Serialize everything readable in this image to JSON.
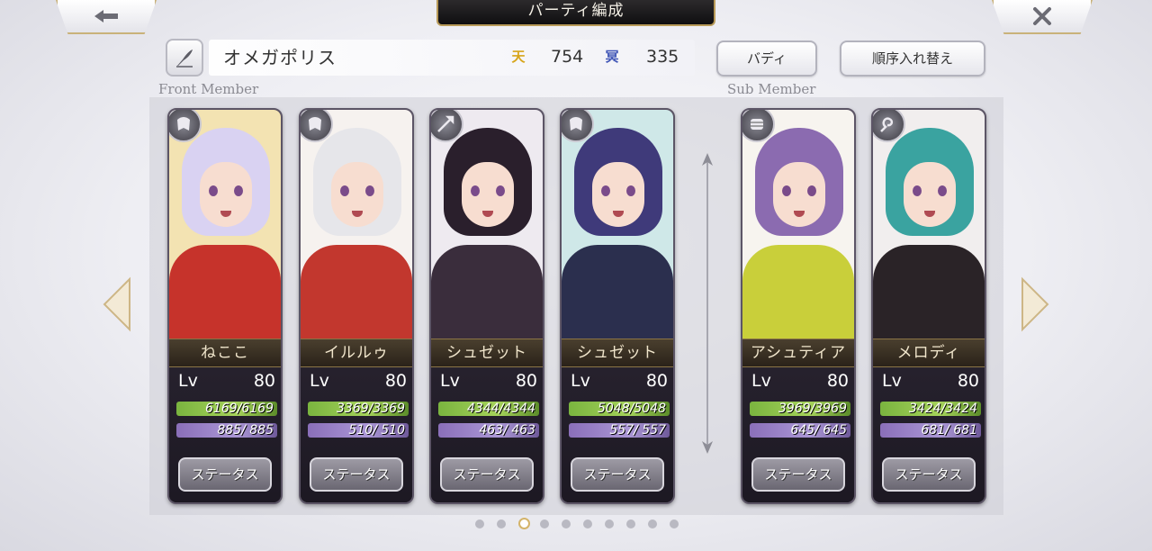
{
  "header": {
    "back_icon": "back-arrow-icon",
    "title": "パーティ編成",
    "close_icon": "close-icon"
  },
  "party": {
    "name": "オメガポリス",
    "ten_icon": "天",
    "ten_value": "754",
    "mei_icon": "冥",
    "mei_value": "335",
    "buddy_label": "バディ",
    "order_label": "順序入れ替え"
  },
  "sections": {
    "front_label": "Front Member",
    "sub_label": "Sub Member"
  },
  "characters": [
    {
      "name": "ねここ",
      "lv_label": "Lv",
      "level": "80",
      "hp": "6169/6169",
      "mp": "885/ 885",
      "status_label": "ステータス",
      "type_icon": "cloak-icon",
      "colors": {
        "hair": "#d9d2f2",
        "outfit": "#c6332b",
        "bg": "#f3e3b2"
      }
    },
    {
      "name": "イルルゥ",
      "lv_label": "Lv",
      "level": "80",
      "hp": "3369/3369",
      "mp": "510/ 510",
      "status_label": "ステータス",
      "type_icon": "cloak-icon",
      "colors": {
        "hair": "#e6e6ea",
        "outfit": "#c2372e",
        "bg": "#f6f2ef"
      }
    },
    {
      "name": "シュゼット",
      "lv_label": "Lv",
      "level": "80",
      "hp": "4344/4344",
      "mp": "463/ 463",
      "status_label": "ステータス",
      "type_icon": "spear-icon",
      "colors": {
        "hair": "#2a1f2c",
        "outfit": "#3a2d3c",
        "bg": "#eeeaf0"
      }
    },
    {
      "name": "シュゼット",
      "lv_label": "Lv",
      "level": "80",
      "hp": "5048/5048",
      "mp": "557/ 557",
      "status_label": "ステータス",
      "type_icon": "cloak-icon",
      "colors": {
        "hair": "#3f3a7a",
        "outfit": "#2b2f4e",
        "bg": "#cfe8e8"
      }
    },
    {
      "name": "アシュティア",
      "lv_label": "Lv",
      "level": "80",
      "hp": "3969/3969",
      "mp": "645/ 645",
      "status_label": "ステータス",
      "type_icon": "fist-icon",
      "colors": {
        "hair": "#8b6bb0",
        "outfit": "#c9cf3a",
        "bg": "#f7f4ef"
      }
    },
    {
      "name": "メロディ",
      "lv_label": "Lv",
      "level": "80",
      "hp": "3424/3424",
      "mp": "681/ 681",
      "status_label": "ステータス",
      "type_icon": "whip-icon",
      "colors": {
        "hair": "#3aa3a0",
        "outfit": "#2a2327",
        "bg": "#f1eeee"
      }
    }
  ],
  "pagination": {
    "total_pages": 10,
    "current_page": 3
  }
}
